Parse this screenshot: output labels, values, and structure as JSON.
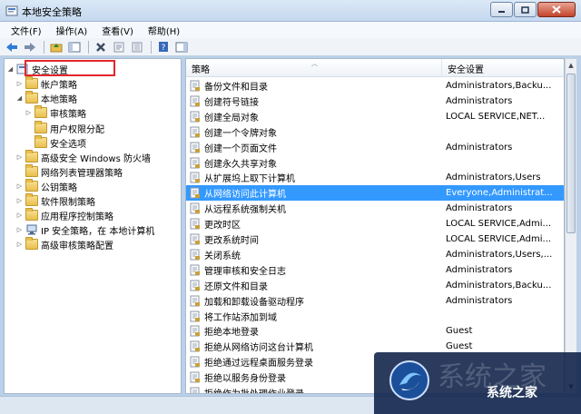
{
  "window": {
    "title": "本地安全策略"
  },
  "menu": [
    "文件(F)",
    "操作(A)",
    "查看(V)",
    "帮助(H)"
  ],
  "tree": [
    {
      "label": "安全设置",
      "level": 0,
      "expanded": true,
      "icon": "security-settings-icon"
    },
    {
      "label": "帐户策略",
      "level": 1,
      "expanded": false,
      "icon": "folder-icon"
    },
    {
      "label": "本地策略",
      "level": 1,
      "expanded": true,
      "icon": "folder-icon"
    },
    {
      "label": "审核策略",
      "level": 2,
      "expanded": false,
      "icon": "folder-icon"
    },
    {
      "label": "用户权限分配",
      "level": 2,
      "expanded": null,
      "icon": "folder-icon",
      "highlighted": true
    },
    {
      "label": "安全选项",
      "level": 2,
      "expanded": null,
      "icon": "folder-icon"
    },
    {
      "label": "高级安全 Windows 防火墙",
      "level": 1,
      "expanded": false,
      "icon": "firewall-icon"
    },
    {
      "label": "网络列表管理器策略",
      "level": 1,
      "expanded": null,
      "icon": "folder-icon"
    },
    {
      "label": "公钥策略",
      "level": 1,
      "expanded": false,
      "icon": "folder-icon"
    },
    {
      "label": "软件限制策略",
      "level": 1,
      "expanded": false,
      "icon": "folder-icon"
    },
    {
      "label": "应用程序控制策略",
      "level": 1,
      "expanded": false,
      "icon": "folder-icon"
    },
    {
      "label": "IP 安全策略，在 本地计算机",
      "level": 1,
      "expanded": false,
      "icon": "ip-security-icon"
    },
    {
      "label": "高级审核策略配置",
      "level": 1,
      "expanded": false,
      "icon": "folder-icon"
    }
  ],
  "list": {
    "columns": [
      "策略",
      "安全设置"
    ],
    "rows": [
      {
        "policy": "备份文件和目录",
        "setting": "Administrators,Backu..."
      },
      {
        "policy": "创建符号链接",
        "setting": "Administrators"
      },
      {
        "policy": "创建全局对象",
        "setting": "LOCAL SERVICE,NET..."
      },
      {
        "policy": "创建一个令牌对象",
        "setting": ""
      },
      {
        "policy": "创建一个页面文件",
        "setting": "Administrators"
      },
      {
        "policy": "创建永久共享对象",
        "setting": ""
      },
      {
        "policy": "从扩展坞上取下计算机",
        "setting": "Administrators,Users"
      },
      {
        "policy": "从网络访问此计算机",
        "setting": "Everyone,Administrat...",
        "selected": true
      },
      {
        "policy": "从远程系统强制关机",
        "setting": "Administrators"
      },
      {
        "policy": "更改时区",
        "setting": "LOCAL SERVICE,Admi..."
      },
      {
        "policy": "更改系统时间",
        "setting": "LOCAL SERVICE,Admi..."
      },
      {
        "policy": "关闭系统",
        "setting": "Administrators,Users,..."
      },
      {
        "policy": "管理审核和安全日志",
        "setting": "Administrators"
      },
      {
        "policy": "还原文件和目录",
        "setting": "Administrators,Backu..."
      },
      {
        "policy": "加载和卸载设备驱动程序",
        "setting": "Administrators"
      },
      {
        "policy": "将工作站添加到域",
        "setting": ""
      },
      {
        "policy": "拒绝本地登录",
        "setting": "Guest"
      },
      {
        "policy": "拒绝从网络访问这台计算机",
        "setting": "Guest"
      },
      {
        "policy": "拒绝通过远程桌面服务登录",
        "setting": ""
      },
      {
        "policy": "拒绝以服务身份登录",
        "setting": ""
      },
      {
        "policy": "拒绝作为批处理作业登录",
        "setting": ""
      }
    ]
  },
  "watermark": {
    "brand": "系统之家"
  },
  "colors": {
    "selection": "#3399ff",
    "highlight_box": "#e2262c"
  }
}
